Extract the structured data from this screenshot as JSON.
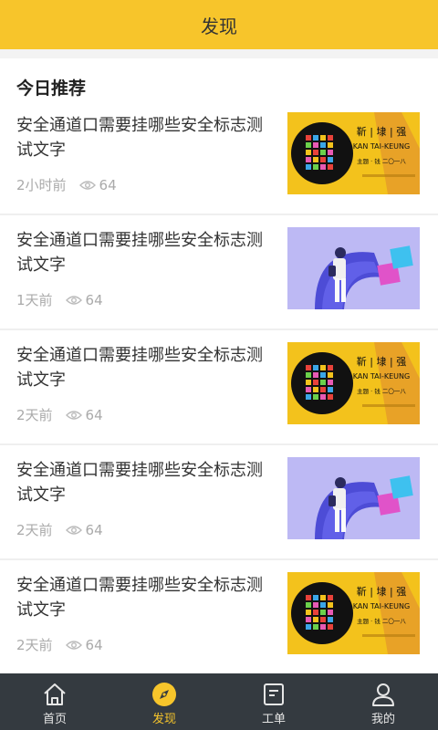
{
  "header": {
    "title": "发现"
  },
  "section": {
    "title": "今日推荐"
  },
  "articles": [
    {
      "title": "安全通道口需要挂哪些安全标志测试文字",
      "time": "2小时前",
      "views": "64",
      "thumb": "poster"
    },
    {
      "title": "安全通道口需要挂哪些安全标志测试文字",
      "time": "1天前",
      "views": "64",
      "thumb": "illustration"
    },
    {
      "title": "安全通道口需要挂哪些安全标志测试文字",
      "time": "2天前",
      "views": "64",
      "thumb": "poster"
    },
    {
      "title": "安全通道口需要挂哪些安全标志测试文字",
      "time": "2天前",
      "views": "64",
      "thumb": "illustration"
    },
    {
      "title": "安全通道口需要挂哪些安全标志测试文字",
      "time": "2天前",
      "views": "64",
      "thumb": "poster"
    }
  ],
  "poster": {
    "name_cn": "靳 | 埭 | 强",
    "name_en": "KAN TAI-KEUNG",
    "subtitle": "主题 · 钱  二〇一八"
  },
  "tabbar": {
    "tabs": [
      {
        "label": "首页",
        "icon": "home-icon"
      },
      {
        "label": "发现",
        "icon": "compass-icon"
      },
      {
        "label": "工单",
        "icon": "document-icon"
      },
      {
        "label": "我的",
        "icon": "user-icon"
      }
    ],
    "active": "发现"
  },
  "colors": {
    "accent": "#f7c52b",
    "tabbar_bg": "#343a40"
  }
}
